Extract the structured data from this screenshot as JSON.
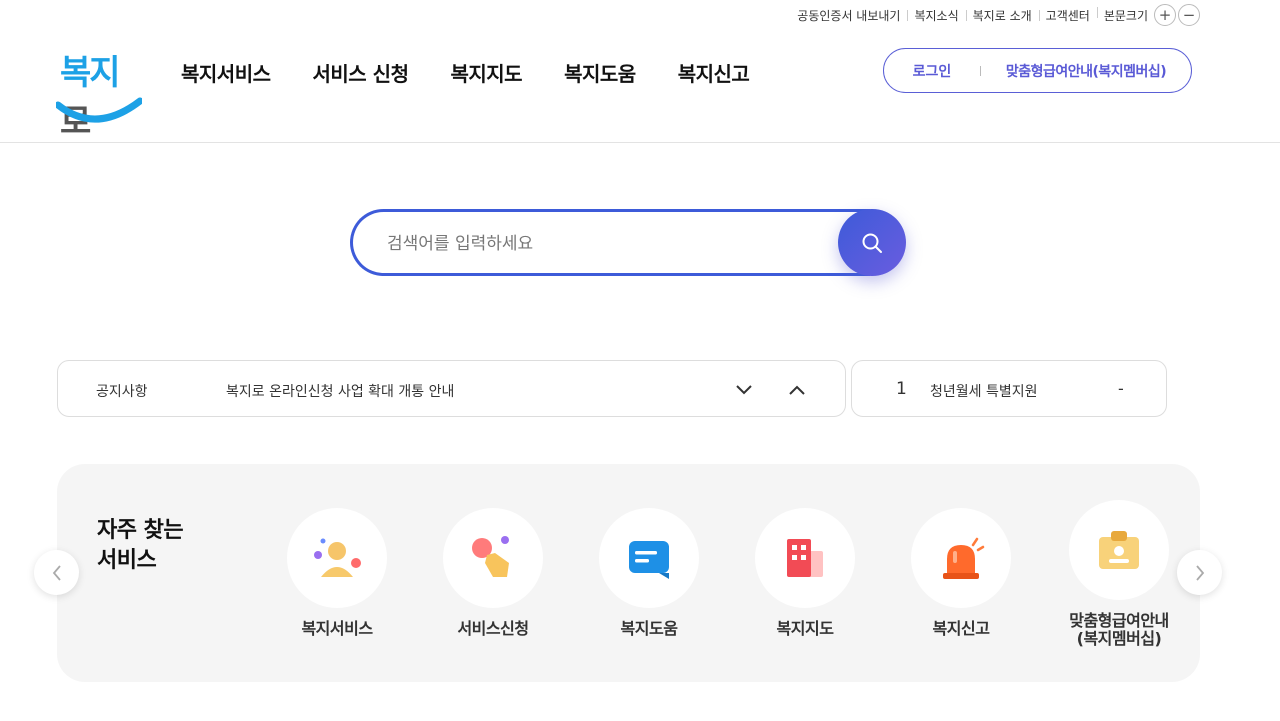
{
  "util": {
    "links": [
      "공동인증서 내보내기",
      "복지소식",
      "복지로 소개",
      "고객센터"
    ],
    "font_size_label": "본문크기",
    "plus": "+",
    "minus": "−"
  },
  "header": {
    "logo": {
      "part1": "복지",
      "part2": "로",
      "accent": "#1da1e6"
    },
    "nav": [
      "복지서비스",
      "서비스 신청",
      "복지지도",
      "복지도움",
      "복지신고"
    ],
    "login": "로그인",
    "member": "맞춤형급여안내(복지멤버십)"
  },
  "search": {
    "placeholder": "검색어를 입력하세요",
    "button_icon": "search-icon",
    "accent": "#3d5bd9"
  },
  "notice": {
    "label": "공지사항",
    "text": "복지로 온라인신청 사업 확대 개통 안내"
  },
  "ranking": {
    "rank": "1",
    "text": "청년월세 특별지원",
    "change": "-"
  },
  "frequent": {
    "title_line1": "자주 찾는",
    "title_line2": "서비스",
    "items": [
      {
        "label": "복지서비스",
        "icon": "people-icon"
      },
      {
        "label": "서비스신청",
        "icon": "hand-click-icon"
      },
      {
        "label": "복지도움",
        "icon": "message-icon"
      },
      {
        "label": "복지지도",
        "icon": "building-icon"
      },
      {
        "label": "복지신고",
        "icon": "siren-icon"
      },
      {
        "label_line1": "맞춤형급여안내",
        "label_line2": "(복지멤버십)",
        "icon": "id-card-icon"
      }
    ]
  }
}
